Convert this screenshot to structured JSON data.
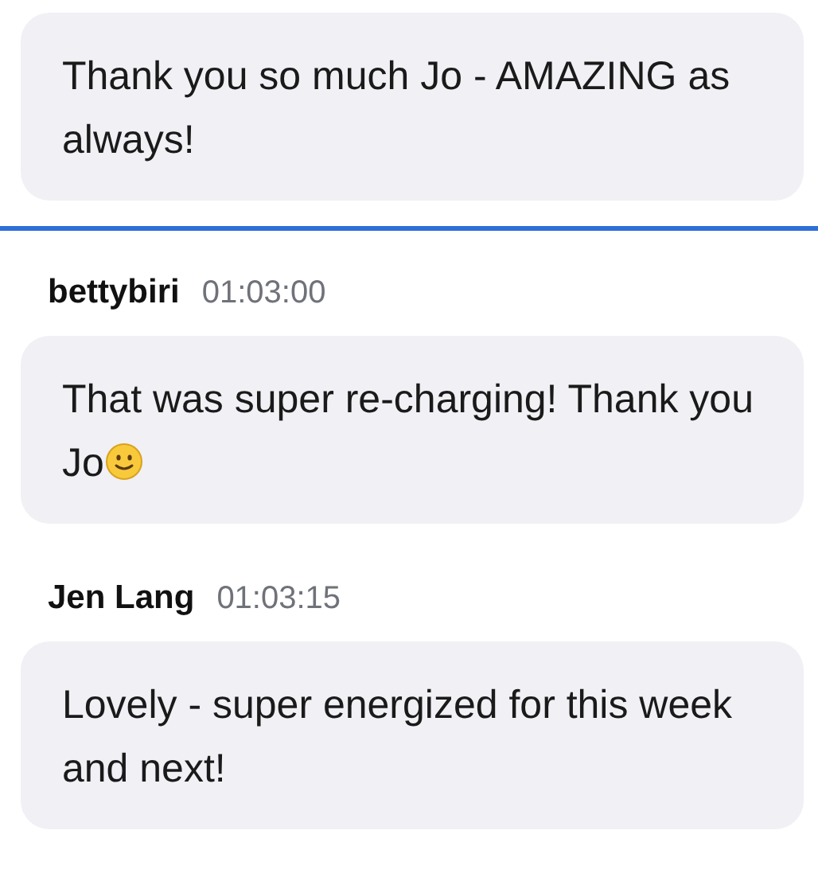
{
  "feed": [
    {
      "kind": "message",
      "text": "Thank you so much Jo - AMAZING as always!"
    },
    {
      "kind": "divider"
    },
    {
      "kind": "message",
      "author": "bettybiri",
      "time": "01:03:00",
      "text": "That was super re-charging! Thank you Jo",
      "smiley": true
    },
    {
      "kind": "message",
      "author": "Jen Lang",
      "time": "01:03:15",
      "text": "Lovely - super energized for this week and next!"
    }
  ]
}
